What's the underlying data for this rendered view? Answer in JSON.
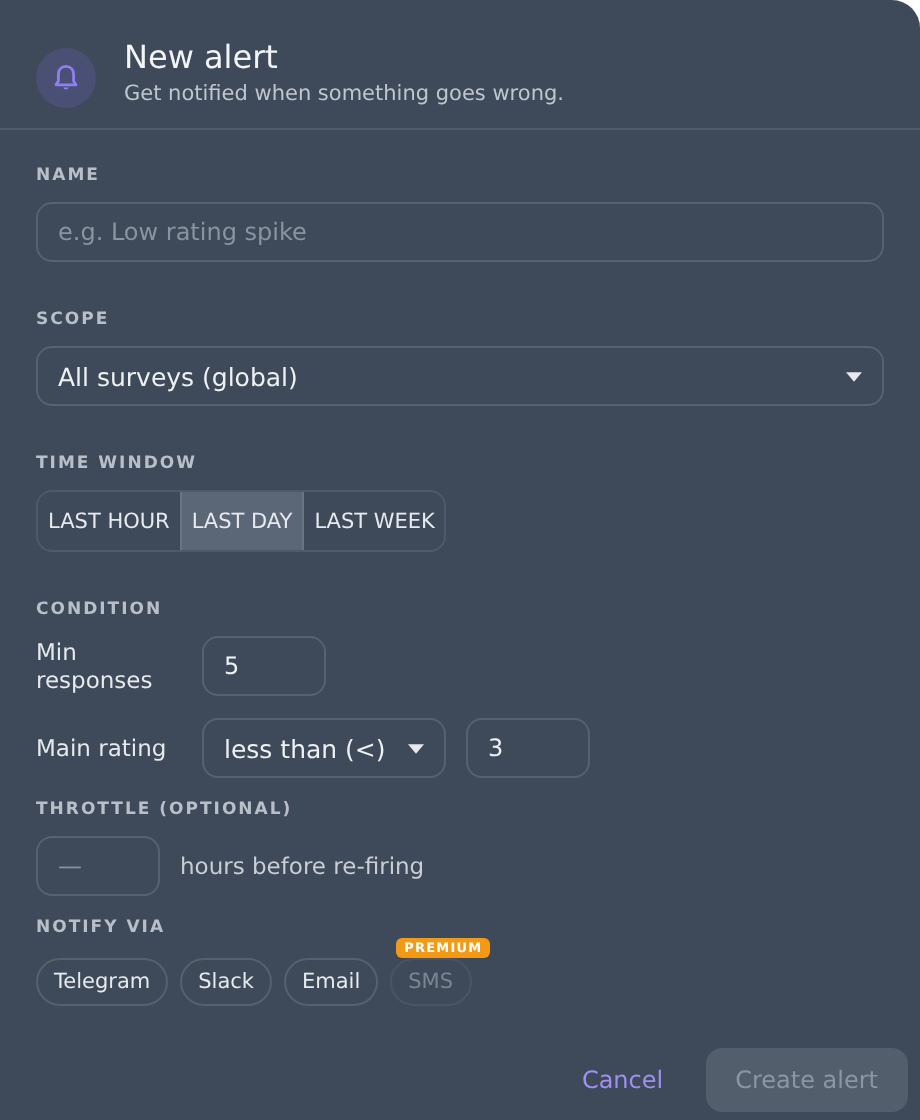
{
  "dialog": {
    "title": "New alert",
    "subtitle": "Get notified when something goes wrong."
  },
  "name": {
    "label": "NAME",
    "placeholder": "e.g. Low rating spike"
  },
  "scope": {
    "label": "SCOPE",
    "value": "All surveys (global)"
  },
  "time_window": {
    "label": "TIME WINDOW",
    "options": [
      {
        "label": "LAST HOUR",
        "selected": false
      },
      {
        "label": "LAST DAY",
        "selected": true
      },
      {
        "label": "LAST WEEK",
        "selected": false
      }
    ]
  },
  "condition": {
    "label": "CONDITION",
    "rows": [
      {
        "kind": "input",
        "label": "Min responses",
        "value": "5"
      },
      {
        "kind": "compare",
        "label": "Main rating",
        "operator": "less than (<)",
        "value": "3"
      }
    ]
  },
  "throttle": {
    "label": "THROTTLE (OPTIONAL)",
    "placeholder": "—",
    "suffix": "hours before re-firing"
  },
  "notify": {
    "label": "NOTIFY VIA",
    "channels": [
      {
        "label": "Telegram",
        "disabled": false
      },
      {
        "label": "Slack",
        "disabled": false
      },
      {
        "label": "Email",
        "disabled": false
      },
      {
        "label": "SMS",
        "disabled": true,
        "badge": "PREMIUM"
      }
    ]
  },
  "buttons": [
    {
      "kind": "link",
      "label": "Cancel",
      "disabled": false
    },
    {
      "kind": "primary",
      "label": "Create alert",
      "disabled": true
    }
  ]
}
